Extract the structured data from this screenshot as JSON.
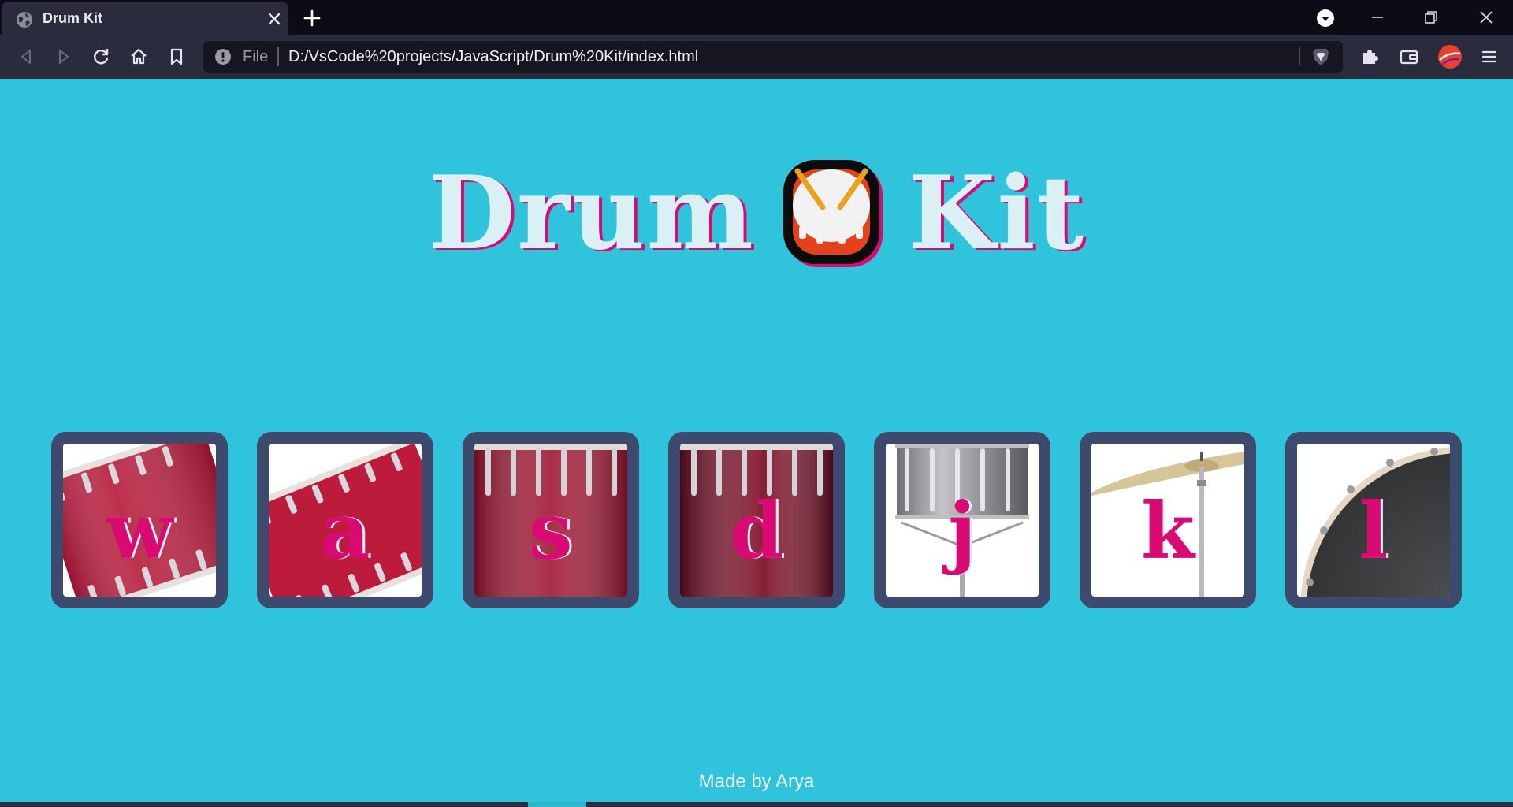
{
  "browser": {
    "tab": {
      "title": "Drum Kit"
    },
    "omnibox": {
      "scheme_label": "File",
      "url": "D:/VsCode%20projects/JavaScript/Drum%20Kit/index.html"
    }
  },
  "page": {
    "heading_left": "Drum",
    "heading_emoji": "drum-emoji",
    "heading_right": "Kit",
    "drums": [
      {
        "key": "w",
        "image": "tom-red-tilted"
      },
      {
        "key": "a",
        "image": "tom-red-tilted"
      },
      {
        "key": "s",
        "image": "snare-red"
      },
      {
        "key": "d",
        "image": "snare-red-dark"
      },
      {
        "key": "j",
        "image": "snare-silver-stand"
      },
      {
        "key": "k",
        "image": "crash-cymbal"
      },
      {
        "key": "l",
        "image": "kick-drum-black"
      }
    ],
    "footer": "Made by Arya"
  },
  "colors": {
    "background": "#2fc4db",
    "drum_frame": "#3d4a6d",
    "accent_pink": "#d90b73",
    "heading_fill": "#daf0f5",
    "chrome_dark": "#0c0c17",
    "chrome_toolbar": "#2a2b3d"
  }
}
